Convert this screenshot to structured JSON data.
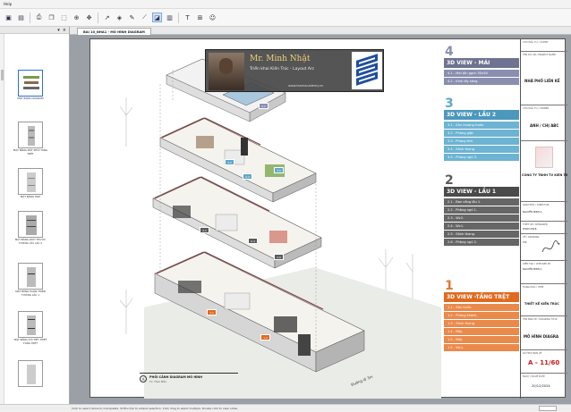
{
  "app": {
    "menu": [
      "Help"
    ]
  },
  "toolbar": {
    "icons": [
      "open-icon",
      "save-icon",
      "print-icon",
      "copy-icon",
      "select-icon",
      "zoom-icon",
      "pan-icon",
      "arrow-icon",
      "markup-icon",
      "pen-icon",
      "measure-icon",
      "snapshot-icon",
      "highlight-icon",
      "text-icon",
      "stamp-icon",
      "settings-icon"
    ]
  },
  "tab": {
    "label": "BAI 10_NHA1 - MÔ HÌNH DIAGRAM"
  },
  "sidebar": {
    "thumbnails": [
      {
        "caption": "MỘT BÀNG DIAGRAM",
        "selected": true
      },
      {
        "caption": "MẶT BẰNG MẶT PHỐI TẦNG TRỆT",
        "selected": false
      },
      {
        "caption": "MẶT BẰNG HỢP",
        "selected": false
      },
      {
        "caption": "MẶT BẰNG KÍCH THƯỚC TƯỜNG XÂY LẦU 2",
        "selected": false
      },
      {
        "caption": "MẶT BẰNG HOÀN THIỆN TƯỜNG LẦU 1",
        "selected": false
      },
      {
        "caption": "MẶT BẰNG CHI TIẾT THIẾT TẦNG TRỆT",
        "selected": false
      }
    ]
  },
  "watermark": {
    "name": "Mr. Minh Nhật",
    "subtitle": "Triển khai Kiến Trúc - Layout Arc",
    "url": "www.learnacademy.vn"
  },
  "legend": [
    {
      "number": "4",
      "color": "#8a8fb0",
      "header": "3D VIEW - MÁI",
      "header_color": "#6d7390",
      "items": [
        "4.1 - Mái tôn gạch 50x50",
        "4.2 - Kính lấy sáng."
      ]
    },
    {
      "number": "3",
      "color": "#5fa9c9",
      "header": "3D VIEW - LẦU 2",
      "header_color": "#4c98bd",
      "items": [
        "3.1 - Sân thượng trước.",
        "3.2 - Phòng giặt.",
        "3.3 - Phòng thờ.",
        "3.4 - Sảnh thang.",
        "3.5 - Phòng ngủ 3."
      ]
    },
    {
      "number": "2",
      "color": "#5b5b5b",
      "header": "3D VIEW - LẦU 1",
      "header_color": "#4a4a4a",
      "items": [
        "2.1 - Ban công lầu 1.",
        "2.2 - Phòng ngủ 1.",
        "2.3 - Wc2.",
        "2.4 - Wc1.",
        "2.5 - Sảnh thang.",
        "2.6 - Phòng ngủ 2."
      ]
    },
    {
      "number": "1",
      "color": "#e0782e",
      "header": "3D VIEW -TẦNG TRỆT",
      "header_color": "#e06a1f",
      "items": [
        "1.1 - Sân trước.",
        "1.2 - Phòng khách.",
        "1.3 - Sảnh thang.",
        "1.4 - Bếp.",
        "1.5 - Bếp.",
        "1.5 - Wc1."
      ]
    }
  ],
  "titleblock": {
    "rows": [
      {
        "label": "CHỦ ĐẦU TƯ / CLIENT",
        "value": ""
      },
      {
        "label": "TÊN DỰ ÁN / PROJECT NAME",
        "value": "NHÀ PHỐ LIÊN KẾ"
      },
      {
        "label": "CHỦ ĐẦU TƯ / OWNER",
        "value": "ANH / CHỊ ABC"
      },
      {
        "label": "",
        "value": "CÔNG TY TNHH TV KIẾN TRÚC-XÂY DỰ"
      },
      {
        "label": "GIÁM ĐỐC / DIRECTOR",
        "value": "NGUYỄN MINH A"
      },
      {
        "label": "THIẾT KẾ / DESIGNER",
        "value": "PHẠM XIN B"
      },
      {
        "label": "VẼ / DRAWING",
        "value": "TÔI"
      },
      {
        "label": "KIỂM TRA / CHECKED BY",
        "value": "NGUYỄN MINH A"
      },
      {
        "label": "HẠNG MỤC / ITEM",
        "value": "THIẾT KẾ KIẾN TRÚC"
      },
      {
        "label": "TÊN BẢN VẼ / DRAWING TITLE",
        "value": "MÔ HÌNH DIAGRA"
      },
      {
        "label": "SỐ HIỆU BẢN VẼ",
        "value": "A - 11/60"
      },
      {
        "label": "NGÀY / ISSUE DATE",
        "value": "20/12/2024"
      }
    ]
  },
  "caption": {
    "number": "A",
    "title": "PHỐI CẢNH DIAGRAM MÔ HÌNH",
    "scale": "TL: Theo Mẫu"
  },
  "drawing": {
    "street_label": "Đường lộ 3m"
  },
  "status": {
    "text": "Click to select items to manipulate. Shift+click to extend selection. Click drag to select multiple. Double click to view notes."
  }
}
